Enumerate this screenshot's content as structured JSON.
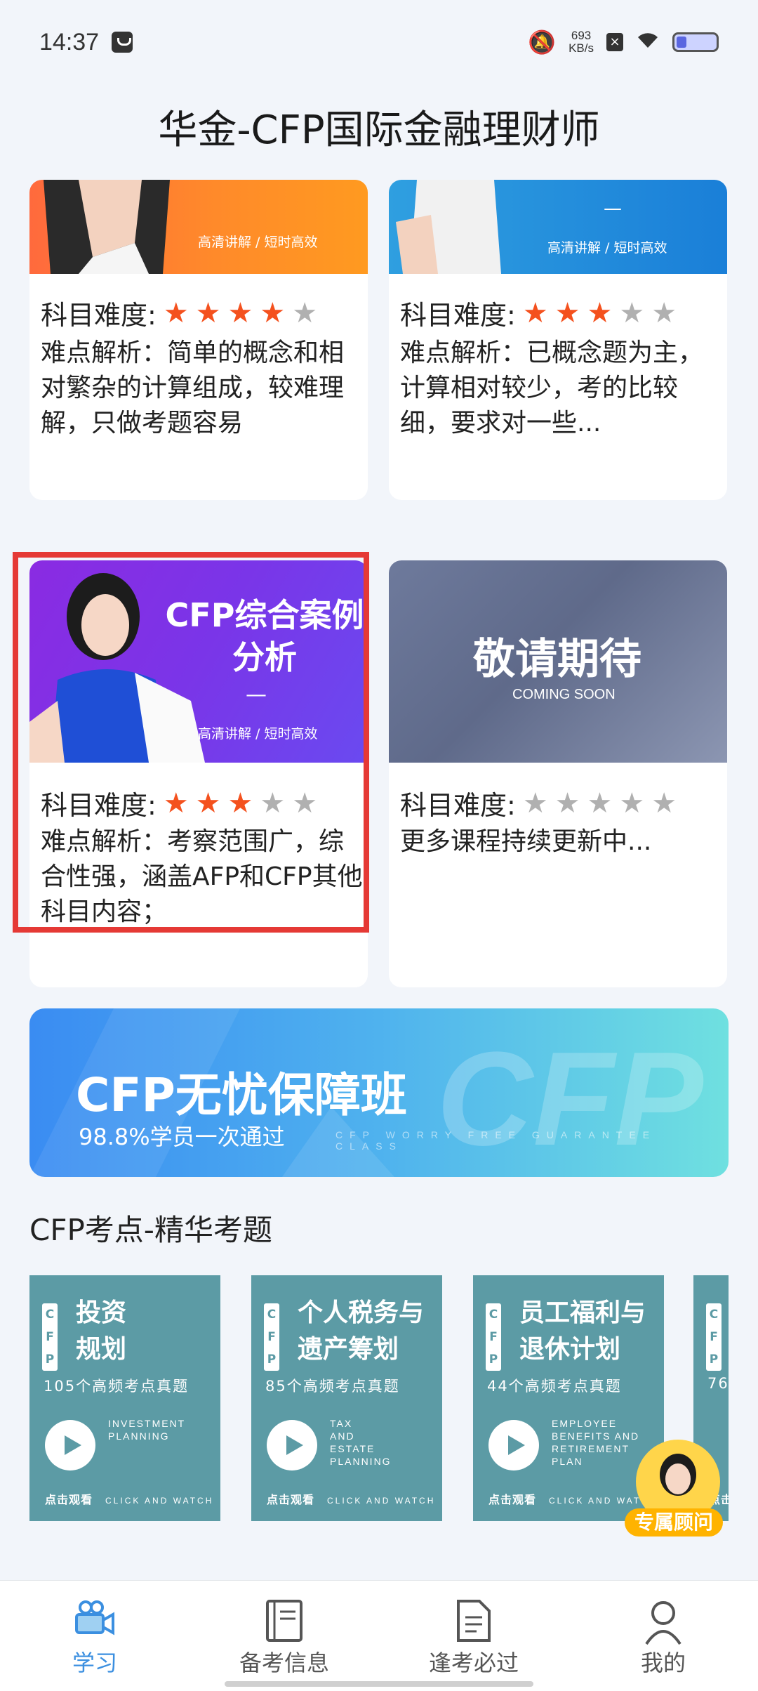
{
  "status_bar": {
    "time": "14:37",
    "speed_value": "693",
    "speed_unit": "KB/s"
  },
  "app_title": "华金-CFP国际金融理财师",
  "courses": [
    {
      "difficulty_label": "科目难度:",
      "difficulty_stars": 4,
      "banner_tag": "高清讲解 / 短时高效",
      "description": "难点解析：简单的概念和相对繁杂的计算组成，较难理解，只做考题容易"
    },
    {
      "difficulty_label": "科目难度:",
      "difficulty_stars": 3,
      "banner_tag": "高清讲解 / 短时高效",
      "description": "难点解析：已概念题为主，计算相对较少，考的比较细，要求对一些..."
    },
    {
      "banner_title": "CFP综合案例\n分析",
      "banner_dash": "—",
      "banner_tag": "高清讲解 / 短时高效",
      "difficulty_label": "科目难度:",
      "difficulty_stars": 3,
      "description": "难点解析：考察范围广，综合性强，涵盖AFP和CFP其他科目内容；"
    },
    {
      "banner_title": "敬请期待",
      "banner_subtitle": "COMING SOON",
      "difficulty_label": "科目难度:",
      "difficulty_stars": 0,
      "description": "更多课程持续更新中..."
    }
  ],
  "promo_banner": {
    "title": "CFP无忧保障班",
    "subtitle": "98.8%学员一次通过",
    "english": "CFP WORRY FREE GUARANTEE CLASS",
    "watermark": "CFP"
  },
  "section_title": "CFP考点-精华考题",
  "exam_cards": [
    {
      "badge": "CFP",
      "title": "投资\n规划",
      "count": "105个高频考点真题",
      "english": "INVESTMENT\nPLANNING",
      "footer": "点击观看",
      "footer_en": "CLICK AND WATCH"
    },
    {
      "badge": "CFP",
      "title": "个人税务与\n遗产筹划",
      "count": "85个高频考点真题",
      "english": "TAX\nAND\nESTATE\nPLANNING",
      "footer": "点击观看",
      "footer_en": "CLICK AND WATCH"
    },
    {
      "badge": "CFP",
      "title": "员工福利与\n退休计划",
      "count": "44个高频考点真题",
      "english": "EMPLOYEE\nBENEFITS AND\nRETIREMENT\nPLAN",
      "footer": "点击观看",
      "footer_en": "CLICK AND WATCH"
    },
    {
      "badge": "CFP",
      "title": "",
      "count": "76",
      "english": "",
      "footer": "点击",
      "footer_en": ""
    }
  ],
  "consultant": {
    "label": "专属顾问"
  },
  "bottom_nav": [
    {
      "label": "学习",
      "icon": "video-camera-icon",
      "active": true
    },
    {
      "label": "备考信息",
      "icon": "book-icon",
      "active": false
    },
    {
      "label": "逢考必过",
      "icon": "document-icon",
      "active": false
    },
    {
      "label": "我的",
      "icon": "person-icon",
      "active": false
    }
  ],
  "colors": {
    "accent": "#3b8fe0",
    "star_on": "#f4511e",
    "star_off": "#b0b0b0",
    "highlight": "#e53935",
    "exam_card": "#5c9ba5"
  }
}
